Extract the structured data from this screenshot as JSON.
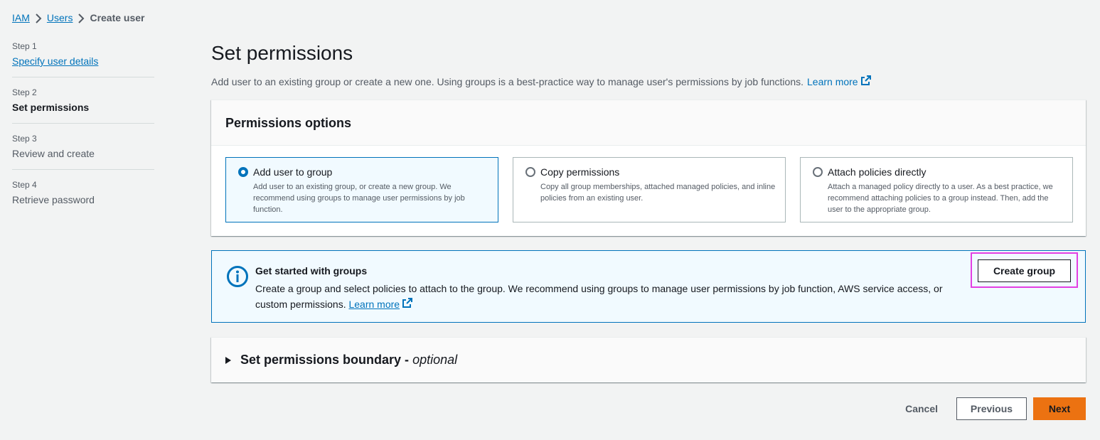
{
  "breadcrumb": {
    "items": [
      {
        "label": "IAM"
      },
      {
        "label": "Users"
      },
      {
        "label": "Create user"
      }
    ]
  },
  "steps": [
    {
      "num": "Step 1",
      "title": "Specify user details"
    },
    {
      "num": "Step 2",
      "title": "Set permissions"
    },
    {
      "num": "Step 3",
      "title": "Review and create"
    },
    {
      "num": "Step 4",
      "title": "Retrieve password"
    }
  ],
  "main": {
    "title": "Set permissions",
    "description": "Add user to an existing group or create a new one. Using groups is a best-practice way to manage user's permissions by job functions.",
    "learn_more": "Learn more"
  },
  "permissions_options": {
    "heading": "Permissions options",
    "options": [
      {
        "title": "Add user to group",
        "description": "Add user to an existing group, or create a new group. We recommend using groups to manage user permissions by job function.",
        "selected": true
      },
      {
        "title": "Copy permissions",
        "description": "Copy all group memberships, attached managed policies, and inline policies from an existing user.",
        "selected": false
      },
      {
        "title": "Attach policies directly",
        "description": "Attach a managed policy directly to a user. As a best practice, we recommend attaching policies to a group instead. Then, add the user to the appropriate group.",
        "selected": false
      }
    ]
  },
  "info_alert": {
    "title": "Get started with groups",
    "text": "Create a group and select policies to attach to the group. We recommend using groups to manage user permissions by job function, AWS service access, or custom permissions.",
    "learn_more": "Learn more",
    "button_label": "Create group"
  },
  "boundary": {
    "title": "Set permissions boundary -",
    "optional": "optional"
  },
  "footer": {
    "cancel": "Cancel",
    "previous": "Previous",
    "next": "Next"
  },
  "colors": {
    "link": "#0073bb",
    "primary_button": "#ec7211",
    "highlight_border": "#e33fe3",
    "selected_bg": "#f1faff"
  },
  "icons": [
    "chevron-right-icon",
    "external-link-icon",
    "info-icon",
    "caret-right-icon",
    "radio-selected-icon",
    "radio-unselected-icon"
  ]
}
